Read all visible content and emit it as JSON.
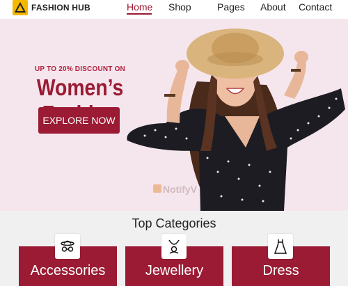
{
  "header": {
    "brand": "FASHION HUB",
    "logo_icon": "triangle-logo-icon",
    "nav": [
      "Home",
      "Shop",
      "Pages",
      "About",
      "Contact"
    ],
    "active_nav": "Home",
    "accent_color": "#9a1b33"
  },
  "hero": {
    "promo": "UP TO 20% DISCOUNT ON",
    "headline": "Women’s Fashion",
    "cta_label": "EXPLORE NOW",
    "background": "#f5e6ee",
    "watermark": "NotifyV"
  },
  "categories": {
    "title": "Top Categories",
    "items": [
      {
        "label": "Accessories",
        "icon": "hat-glasses-icon"
      },
      {
        "label": "Jewellery",
        "icon": "necklace-icon"
      },
      {
        "label": "Dress",
        "icon": "dress-icon"
      }
    ]
  }
}
